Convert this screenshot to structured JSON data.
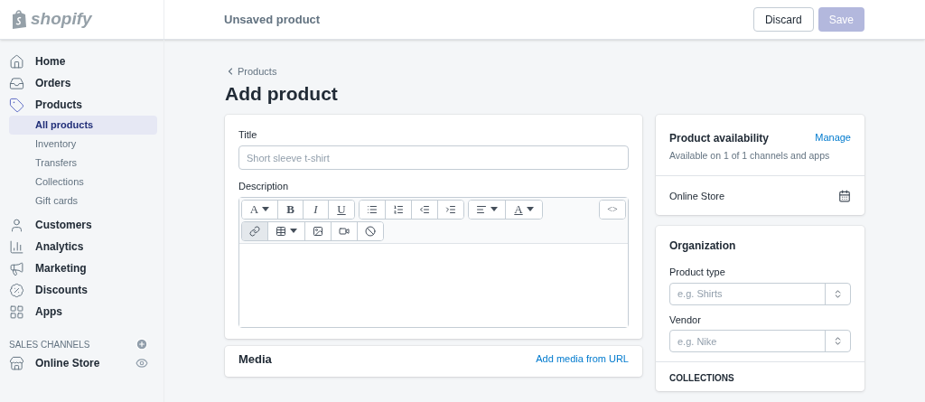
{
  "brand": {
    "name": "shopify"
  },
  "topbar": {
    "title": "Unsaved product",
    "buttons": [
      {
        "label": "Discard",
        "kind": "secondary",
        "disabled": false
      },
      {
        "label": "Save",
        "kind": "primary",
        "disabled": true
      }
    ]
  },
  "sidebar": {
    "items": [
      {
        "label": "Home",
        "kind": "home",
        "selected": false
      },
      {
        "label": "Orders",
        "kind": "orders",
        "selected": false
      },
      {
        "label": "Products",
        "kind": "products",
        "selected": true,
        "children": [
          {
            "label": "All products",
            "selected": true
          },
          {
            "label": "Inventory",
            "selected": false
          },
          {
            "label": "Transfers",
            "selected": false
          },
          {
            "label": "Collections",
            "selected": false
          },
          {
            "label": "Gift cards",
            "selected": false
          }
        ]
      },
      {
        "label": "Customers",
        "kind": "customers",
        "selected": false
      },
      {
        "label": "Analytics",
        "kind": "analytics",
        "selected": false
      },
      {
        "label": "Marketing",
        "kind": "marketing",
        "selected": false
      },
      {
        "label": "Discounts",
        "kind": "discounts",
        "selected": false
      },
      {
        "label": "Apps",
        "kind": "apps",
        "selected": false
      }
    ],
    "section": {
      "title": "SALES CHANNELS",
      "items": [
        {
          "label": "Online Store",
          "kind": "store"
        }
      ]
    }
  },
  "breadcrumb": "Products",
  "page_title": "Add product",
  "product_form": {
    "title_label": "Title",
    "title_placeholder": "Short sleeve t-shirt",
    "description_label": "Description",
    "toolbar": [
      [
        [
          {
            "kind": "font",
            "label": "A",
            "caret": true
          },
          {
            "kind": "bold",
            "label": "B"
          },
          {
            "kind": "italic",
            "label": "I"
          },
          {
            "kind": "underline",
            "label": "U"
          }
        ],
        [
          {
            "kind": "bullets"
          },
          {
            "kind": "numbers"
          },
          {
            "kind": "outdent"
          },
          {
            "kind": "indent"
          }
        ],
        [
          {
            "kind": "align",
            "caret": true
          },
          {
            "kind": "color",
            "label": "A",
            "caret": true
          }
        ],
        [
          {
            "kind": "html",
            "label": "<>"
          }
        ]
      ],
      [
        [
          {
            "kind": "link",
            "pressed": true
          },
          {
            "kind": "table",
            "caret": true
          },
          {
            "kind": "image"
          },
          {
            "kind": "video"
          },
          {
            "kind": "clear"
          }
        ]
      ]
    ]
  },
  "media": {
    "title": "Media",
    "link": "Add media from URL"
  },
  "availability": {
    "title": "Product availability",
    "action": "Manage",
    "subtitle": "Available on 1 of 1 channels and apps",
    "channels": [
      {
        "label": "Online Store"
      }
    ]
  },
  "organization": {
    "title": "Organization",
    "fields": [
      {
        "label": "Product type",
        "placeholder": "e.g. Shirts"
      },
      {
        "label": "Vendor",
        "placeholder": "e.g. Nike"
      }
    ],
    "collections_label": "COLLECTIONS"
  }
}
